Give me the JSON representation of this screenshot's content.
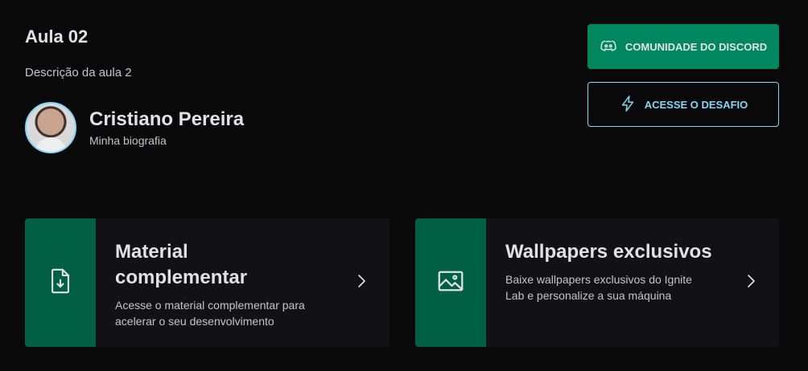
{
  "lesson": {
    "title": "Aula 02",
    "description": "Descrição da aula 2"
  },
  "teacher": {
    "name": "Cristiano Pereira",
    "bio": "Minha biografia"
  },
  "buttons": {
    "discord": "Comunidade do Discord",
    "challenge": "Acesse o desafio"
  },
  "cards": [
    {
      "title": "Material complementar",
      "text": "Acesse o material complementar para acelerar o seu desenvolvimento",
      "icon": "file-download-icon"
    },
    {
      "title": "Wallpapers exclusivos",
      "text": "Baixe wallpapers exclusivos do Ignite Lab e personalize a sua máquina",
      "icon": "image-icon"
    }
  ],
  "colors": {
    "background": "#09090a",
    "card": "#121214",
    "green": "#00875f",
    "green_dark": "#015f43",
    "blue": "#81d8f7"
  }
}
